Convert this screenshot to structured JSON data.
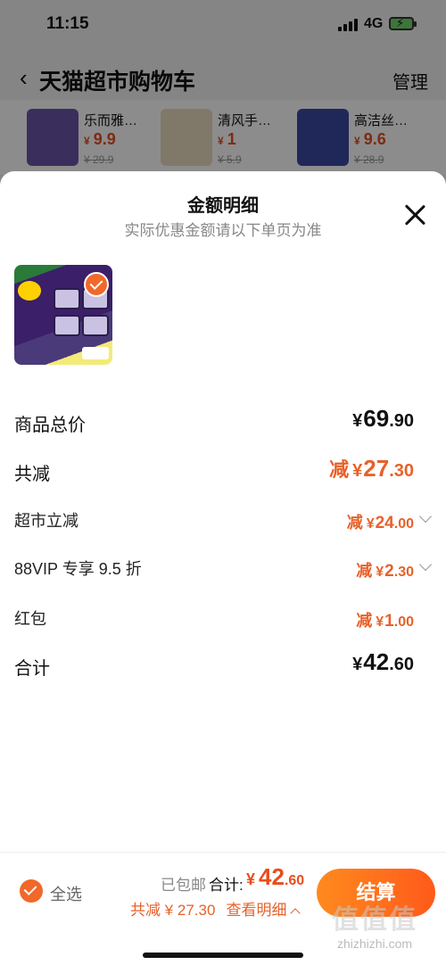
{
  "status_bar": {
    "time": "11:15",
    "network": "4G"
  },
  "nav": {
    "back_icon": "chevron-left-icon",
    "title": "天猫超市购物车",
    "manage_label": "管理"
  },
  "product_strip": [
    {
      "name": "乐而雅…",
      "price_symbol": "¥",
      "price": "9.9",
      "original": "¥ 29.9",
      "color": "#6b57a8"
    },
    {
      "name": "清风手…",
      "price_symbol": "¥",
      "price": "1",
      "original": "¥ 5.9",
      "color": "#e9dcc0"
    },
    {
      "name": "高洁丝…",
      "price_symbol": "¥",
      "price": "9.6",
      "original": "¥ 28.9",
      "color": "#3a4aa0"
    }
  ],
  "sheet": {
    "title": "金额明细",
    "subtitle": "实际优惠金额请以下单页为准",
    "close_icon": "close-icon",
    "rows": [
      {
        "label": "商品总价",
        "prefix": "",
        "yen": "¥",
        "int": "69",
        "cents": ".90"
      },
      {
        "label": "共减",
        "prefix": "减",
        "yen": "¥",
        "int": "27",
        "cents": ".30"
      },
      {
        "label": "超市立减",
        "prefix": "减",
        "yen": "¥",
        "int": "24",
        "cents": ".00"
      },
      {
        "label": "88VIP 专享 9.5 折",
        "prefix": "减",
        "yen": "¥",
        "int": "2",
        "cents": ".30"
      },
      {
        "label": "红包",
        "prefix": "减",
        "yen": "¥",
        "int": "1",
        "cents": ".00"
      },
      {
        "label": "合计",
        "prefix": "",
        "yen": "¥",
        "int": "42",
        "cents": ".60"
      }
    ]
  },
  "bottom_bar": {
    "select_all_label": "全选",
    "shipping_label": "已包邮",
    "total_label": "合计:",
    "total_yen": "¥",
    "total_int": "42",
    "total_cents": ".60",
    "discount_text": "共减 ¥ 27.30",
    "detail_label": "查看明细",
    "checkout_label": "结算",
    "watermark_main": "值值值",
    "watermark_url": "zhizhizhi.com"
  },
  "colors": {
    "accent": "#e8612a",
    "price": "#e84d1c",
    "checkout_start": "#ff8a1e",
    "checkout_end": "#ff5a1a"
  }
}
